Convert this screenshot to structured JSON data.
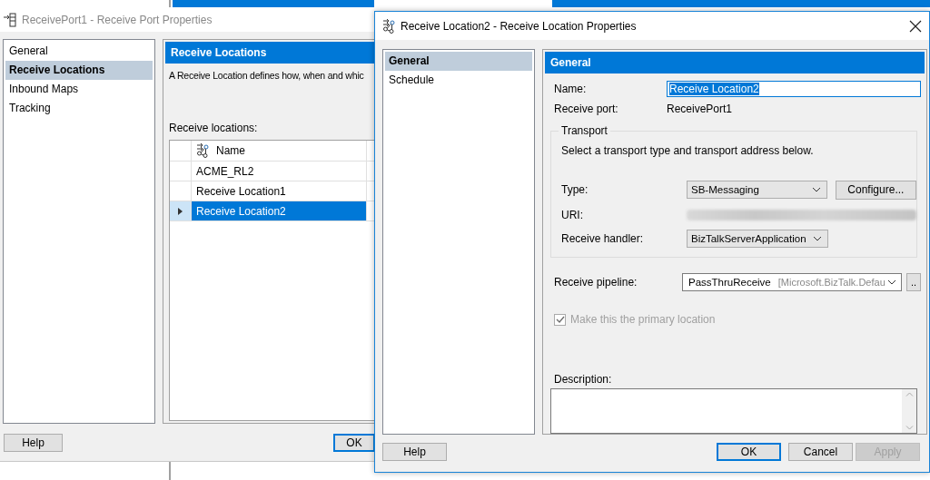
{
  "back_window": {
    "title": "ReceivePort1 - Receive Port Properties",
    "pages": [
      {
        "label": "General",
        "selected": false
      },
      {
        "label": "Receive Locations",
        "selected": true
      },
      {
        "label": "Inbound Maps",
        "selected": false
      },
      {
        "label": "Tracking",
        "selected": false
      }
    ],
    "section_title": "Receive Locations",
    "description": "A Receive Location defines how, when and whic",
    "list_label": "Receive locations:",
    "table": {
      "columns": [
        "Name"
      ],
      "rows": [
        {
          "name": "ACME_RL2",
          "selected": false
        },
        {
          "name": "Receive Location1",
          "selected": false
        },
        {
          "name": "Receive Location2",
          "selected": true
        }
      ]
    },
    "buttons": [
      {
        "label": "Help",
        "kind": "normal"
      },
      {
        "label": "OK",
        "kind": "default"
      }
    ]
  },
  "front_window": {
    "title": "Receive Location2 - Receive Location Properties",
    "pages": [
      {
        "label": "General",
        "selected": true
      },
      {
        "label": "Schedule",
        "selected": false
      }
    ],
    "section_title": "General",
    "name": {
      "label": "Name:",
      "value": "Receive Location2"
    },
    "receive_port": {
      "label": "Receive port:",
      "value": "ReceivePort1"
    },
    "transport": {
      "legend": "Transport",
      "hint": "Select a transport type and transport address below.",
      "type": {
        "label": "Type:",
        "value": "SB-Messaging"
      },
      "configure_button": "Configure...",
      "uri": {
        "label": "URI:"
      },
      "handler": {
        "label": "Receive handler:",
        "value": "BizTalkServerApplication"
      }
    },
    "pipeline": {
      "label": "Receive pipeline:",
      "value": "PassThruReceive",
      "assembly": "[Microsoft.BizTalk.Defau",
      "browse_button": ".."
    },
    "primary": {
      "label": "Make this the primary location",
      "checked": true,
      "disabled": true
    },
    "description": {
      "label": "Description:"
    },
    "buttons": [
      {
        "label": "Help",
        "kind": "normal",
        "disabled": false
      },
      {
        "label": "OK",
        "kind": "default",
        "disabled": false
      },
      {
        "label": "Cancel",
        "kind": "normal",
        "disabled": false
      },
      {
        "label": "Apply",
        "kind": "normal",
        "disabled": true
      }
    ]
  }
}
